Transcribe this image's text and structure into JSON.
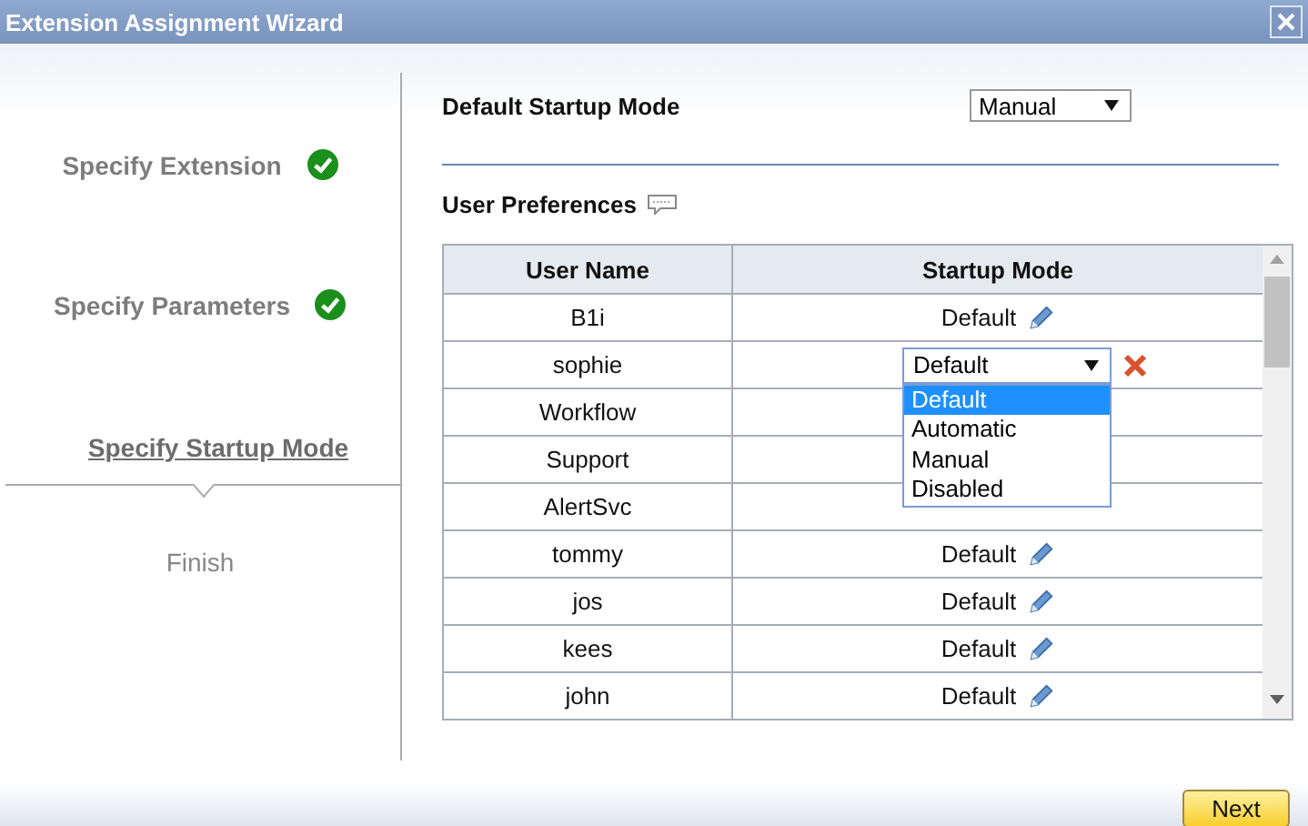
{
  "window": {
    "title": "Extension Assignment Wizard"
  },
  "steps": [
    {
      "label": "Specify Extension",
      "completed": true,
      "selected": false
    },
    {
      "label": "Specify Parameters",
      "completed": true,
      "selected": false
    },
    {
      "label": "Specify Startup Mode",
      "completed": false,
      "selected": true
    },
    {
      "label": "Finish",
      "completed": false,
      "selected": false
    }
  ],
  "default_startup_mode": {
    "label": "Default Startup Mode",
    "value": "Manual"
  },
  "user_preferences": {
    "title": "User Preferences",
    "columns": [
      "User Name",
      "Startup Mode"
    ],
    "rows": [
      {
        "user": "B1i",
        "mode": "Default",
        "editing": false
      },
      {
        "user": "sophie",
        "mode": "Default",
        "editing": true,
        "options": [
          {
            "label": "Default",
            "selected": true
          },
          {
            "label": "Automatic",
            "selected": false
          },
          {
            "label": "Manual",
            "selected": false
          },
          {
            "label": "Disabled",
            "selected": false
          }
        ]
      },
      {
        "user": "Workflow",
        "editing": false
      },
      {
        "user": "Support",
        "editing": false
      },
      {
        "user": "AlertSvc",
        "editing": false
      },
      {
        "user": "tommy",
        "mode": "Default",
        "editing": false
      },
      {
        "user": "jos",
        "mode": "Default",
        "editing": false
      },
      {
        "user": "kees",
        "mode": "Default",
        "editing": false
      },
      {
        "user": "john",
        "mode": "Default",
        "editing": false
      }
    ]
  },
  "buttons": [
    "Next"
  ]
}
